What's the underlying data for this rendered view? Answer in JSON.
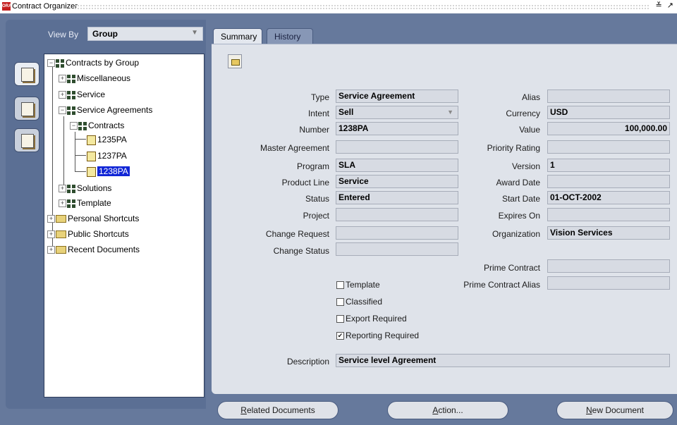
{
  "window": {
    "title": "Contract Organizer",
    "logo_text": "ORACLE",
    "controls": "≚ ↗"
  },
  "viewby": {
    "label": "View By",
    "value": "Group"
  },
  "tree": {
    "root": "Contracts by Group",
    "misc": "Miscellaneous",
    "service": "Service",
    "service_agreements": "Service Agreements",
    "contracts": "Contracts",
    "c1": "1235PA",
    "c2": "1237PA",
    "c3": "1238PA",
    "solutions": "Solutions",
    "template": "Template",
    "personal": "Personal Shortcuts",
    "public": "Public Shortcuts",
    "recent": "Recent Documents"
  },
  "tabs": {
    "summary": "Summary",
    "history": "History"
  },
  "form": {
    "type_label": "Type",
    "type_value": "Service Agreement",
    "intent_label": "Intent",
    "intent_value": "Sell",
    "number_label": "Number",
    "number_value": "1238PA",
    "master_label": "Master Agreement",
    "master_value": "",
    "program_label": "Program",
    "program_value": "SLA",
    "product_label": "Product Line",
    "product_value": "Service",
    "status_label": "Status",
    "status_value": "Entered",
    "project_label": "Project",
    "project_value": "",
    "change_req_label": "Change Request",
    "change_req_value": "",
    "change_status_label": "Change Status",
    "change_status_value": "",
    "alias_label": "Alias",
    "alias_value": "",
    "currency_label": "Currency",
    "currency_value": "USD",
    "value_label": "Value",
    "value_value": "100,000.00",
    "priority_label": "Priority Rating",
    "priority_value": "",
    "version_label": "Version",
    "version_value": "1",
    "award_label": "Award Date",
    "award_value": "",
    "start_label": "Start Date",
    "start_value": "01-OCT-2002",
    "expires_label": "Expires On",
    "expires_value": "",
    "org_label": "Organization",
    "org_value": "Vision Services",
    "prime_label": "Prime Contract",
    "prime_value": "",
    "prime_alias_label": "Prime Contract Alias",
    "prime_alias_value": "",
    "desc_label": "Description",
    "desc_value": "Service level Agreement"
  },
  "checkboxes": {
    "template": {
      "label": "Template",
      "checked": false
    },
    "classified": {
      "label": "Classified",
      "checked": false
    },
    "export": {
      "label": "Export Required",
      "checked": false
    },
    "reporting": {
      "label": "Reporting Required",
      "checked": true
    }
  },
  "buttons": {
    "related_key": "R",
    "related_rest": "elated Documents",
    "action_key": "A",
    "action_rest": "ction...",
    "new_key": "N",
    "new_rest": "ew Document"
  }
}
